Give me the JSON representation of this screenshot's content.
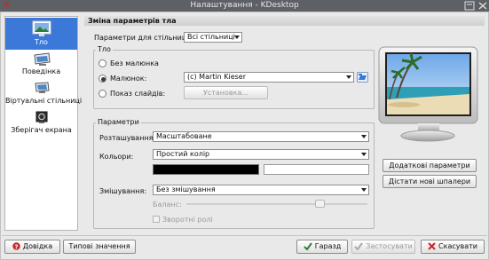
{
  "window": {
    "title": "Налаштування - KDesktop"
  },
  "sidebar": {
    "items": [
      {
        "label": "Тло",
        "icon": "wallpaper-icon",
        "selected": true
      },
      {
        "label": "Поведінка",
        "icon": "desktop-behavior-icon",
        "selected": false
      },
      {
        "label": "Віртуальні стільниці",
        "icon": "virtual-desktops-icon",
        "selected": false
      },
      {
        "label": "Зберігач екрана",
        "icon": "screensaver-icon",
        "selected": false
      }
    ]
  },
  "header": {
    "title": "Зміна параметрів тла"
  },
  "desktop_selector": {
    "label": "Параметри для стільниці:",
    "value": "Всі стільниці"
  },
  "background_group": {
    "title": "Тло",
    "options": {
      "no_picture": "Без малюнка",
      "picture": "Малюнок:",
      "slideshow": "Показ слайдів:"
    },
    "picture_value": "(c) Martin Kieser",
    "setup_button": "Установка..."
  },
  "params_group": {
    "title": "Параметри",
    "position_label": "Розташування:",
    "position_value": "Масштабоване",
    "colors_label": "Кольори:",
    "colors_value": "Простий колір",
    "blend_label": "Змішування:",
    "blend_value": "Без змішування",
    "balance_label": "Баланс:",
    "reverse_roles_label": "Зворотні ролі"
  },
  "side_buttons": {
    "advanced": "Додаткові параметри",
    "get_new": "Дістати нові шпалери"
  },
  "footer": {
    "help": "Довідка",
    "defaults": "Типові значення",
    "ok": "Гаразд",
    "apply": "Застосувати",
    "cancel": "Скасувати"
  },
  "colors": {
    "accent": "#3c78d8",
    "title_bar": "#5d6064",
    "primary_color": "#000000",
    "secondary_color": "#ffffff"
  }
}
